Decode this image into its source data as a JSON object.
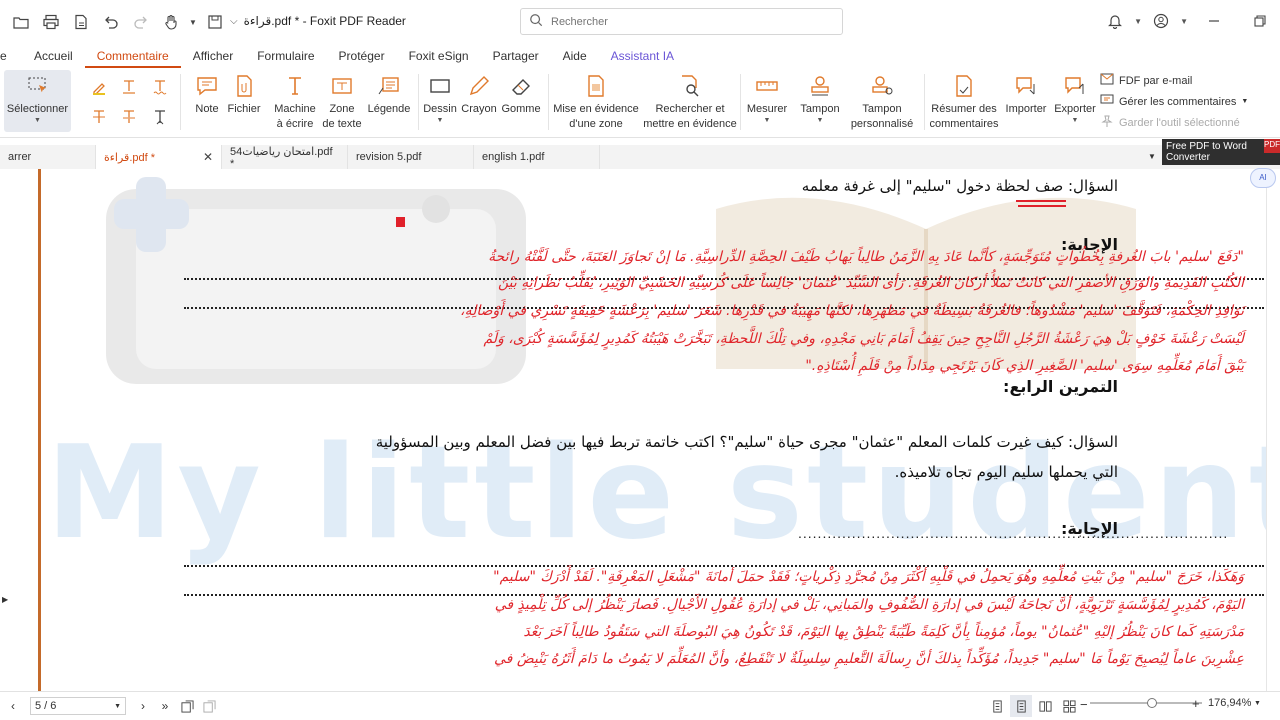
{
  "window": {
    "title": "قراءة.pdf * - Foxit PDF Reader"
  },
  "search": {
    "placeholder": "Rechercher"
  },
  "menu": {
    "items": [
      "Accueil",
      "Commentaire",
      "Afficher",
      "Formulaire",
      "Protéger",
      "Foxit eSign",
      "Partager",
      "Aide",
      "Assistant IA"
    ],
    "active": "Commentaire"
  },
  "ribbon": {
    "select": "Sélectionner",
    "note": "Note",
    "file": "Fichier",
    "typewriter": [
      "Machine",
      "à écrire"
    ],
    "textbox": [
      "Zone",
      "de texte"
    ],
    "callout": "Légende",
    "drawing": "Dessin",
    "pencil": "Crayon",
    "eraser": "Gomme",
    "highlight_area": [
      "Mise en évidence",
      "d'une zone"
    ],
    "search_highlight": [
      "Rechercher et",
      "mettre en évidence"
    ],
    "measure": "Mesurer",
    "stamp": "Tampon",
    "custom_stamp": [
      "Tampon",
      "personnalisé"
    ],
    "summarize": [
      "Résumer des",
      "commentaires"
    ],
    "import": "Importer",
    "export": "Exporter",
    "fdf_email": "FDF par e-mail",
    "manage_comments": "Gérer les commentaires",
    "keep_tool": "Garder l'outil sélectionné"
  },
  "tabs": [
    {
      "label": "arrer",
      "active": false
    },
    {
      "label": "قراءة.pdf *",
      "active": true
    },
    {
      "label": "امتحان رياضيات54.pdf *",
      "active": false
    },
    {
      "label": "revision 5.pdf",
      "active": false
    },
    {
      "label": "english 1.pdf",
      "active": false
    }
  ],
  "banner": {
    "line1": "Free PDF to Word",
    "line2": "Converter",
    "badge": "PDF"
  },
  "ai_badge": "AI",
  "document": {
    "watermark": "My little student",
    "q1": "السؤال: صف لحظة دخول \"سليم\" إلى غرفة معلمه",
    "answer_label1": "الإجابة:",
    "red_lines1": [
      "\"دَفَعَ 'سليم' بابَ الغُرفةِ بِخُطُواتٍ مُتَوَجِّسَةٍ، كأنَّما عَادَ بِهِ الزَّمَنُ طالِباً يَهابُ طَيْفَ الحِصَّةِ الدِّراسِيَّةِ. مَا إنْ تَجاوَزَ العَتَبَةَ، حتَّى لَفَّتْهُ رائحةُ",
      "الكُتُبِ القَدِيمةِ والوَرَقِ الأصفرِ التي كانَتْ تَملأُ أركانَ الغُرفَةِ. رَأى السَّيِّدَ 'عُثمانَ' جالِساً عَلَى كُرسِيِّهِ الخَشَبِيِّ الوَثِيرِ، يُقَلِّبُ نَظَراتِهِ بَيْنَ",
      "نَوَافِذِ الحِكْمَةِ، فَتَوَقَّفَ 'سليم' مَشْدُوهاً؛ فالغُرفَةُ بَسِيطَةٌ في مَظهَرِها، لكنَّها مَهِيبَةٌ في قَدْرِها. شَعَرَ 'سليم' بِرَعْشَةٍ خَفِيفَةٍ تَسْرِي في أَوْصالِهِ،",
      "لَيْسَتْ رَعْشَةَ خَوْفٍ بَلْ هِيَ رَعْشَةُ الرَّجُلِ النَّاجِحِ حِينَ يَقِفُ أَمَامَ بَانِي مَجْدِهِ، وفي تِلْكَ اللَّحظةِ، تَبَخَّرَتْ هَيْبَتُهُ كَمُدِيرٍ لِمُؤَسَّسَةٍ كُبْرَى، وَلَمْ",
      "يَبْقَ أَمَامَ مُعَلِّمِهِ سِوَى 'سليم' الصَّغِيرِ الذِي كَانَ يَرْتَجِي مِدَاداً مِنْ قَلَمِ أُسْتَاذِهِ.\""
    ],
    "exercise4": "التمرين الرابع:",
    "q2_line1": "السؤال: كيف غيرت كلمات المعلم \"عثمان\" مجرى حياة \"سليم\"؟ اكتب خاتمة تربط فيها بين فضل المعلم وبين المسؤولية",
    "q2_line2": "التي يحملها سليم اليوم تجاه تلاميذه.",
    "answer_label2": "الإجابة:",
    "answer_dots": "........................................................................................",
    "red_lines2": [
      "وَهَكَذا، خَرَجَ \"سليم\" مِنْ بَيْتِ مُعلِّمِهِ وهُوَ يَحمِلُ في قَلْبِهِ أكْثَرَ مِنْ مُجرَّدِ ذِكْرياتٍ؛ فَقَدْ حمَلَ أمانَةَ \"مَشْعَلِ المَعْرِفَةِ\". لَقَدْ أَدْرَكَ \"سليم\"",
      "اليَوْمَ، كَمُدِيرٍ لِمُؤَسَّسَةٍ تَرْبَوِيَّةٍ، أنَّ نَجاحَهُ لَيْسَ في إدارَةِ الصُّفُوفِ والمَبانِي، بَلْ في إدارَةِ عُقُولِ الأَجْيالِ. فَصارَ يَنْظُرُ إلى كُلِّ تِلْمِيذٍ في",
      "مَدْرَسَتِهِ كَما كانَ يَنْظُرُ إليْهِ \"عُثمانُ\" يوماً، مُؤمِناً بِأنَّ كَلِمَةً طَيِّبَةً يَنْطِقُ بِها اليَوْمَ، قَدْ تَكُونُ هِيَ البُوصلَةَ التي سَتَقُودُ طالِباً آخَرَ بَعْدَ",
      "عِشْرِينَ عاماً لِيُصبِحَ يَوْماً مَا \"سليم\" جَدِيداً، مُؤَكِّداً بِذلكَ أنَّ رِسالَةَ التَّعليمِ سِلسِلَةٌ لا تَنْقَطِعُ، وأنَّ المُعَلِّمَ لا يَمُوتُ ما دَامَ أَثَرُهُ يَنْبِضُ في"
    ]
  },
  "status": {
    "page": "5 / 6",
    "zoom": "176,94%",
    "zoom_level": 0.5
  }
}
